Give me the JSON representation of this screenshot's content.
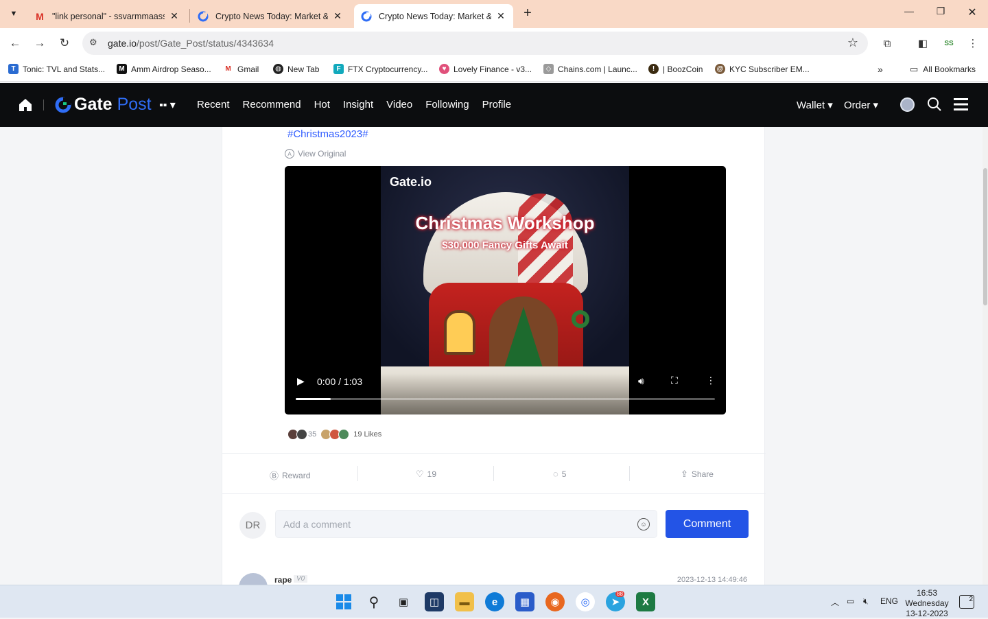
{
  "browser": {
    "tabs": [
      {
        "title": "\"link personal\" - ssvarmmaasso",
        "favicon": "gmail-icon",
        "active": false
      },
      {
        "title": "Crypto News Today: Market & T",
        "favicon": "gate-icon",
        "active": false
      },
      {
        "title": "Crypto News Today: Market & T",
        "favicon": "gate-icon",
        "active": true
      }
    ],
    "url_host": "gate.io",
    "url_path": "/post/Gate_Post/status/4343634",
    "bookmarks": [
      {
        "label": "Tonic: TVL and Stats...",
        "color": "#2a6bd1"
      },
      {
        "label": "Amm Airdrop Seaso...",
        "color": "#111111"
      },
      {
        "label": "Gmail",
        "color": "#d93025"
      },
      {
        "label": "New Tab",
        "color": "#222222"
      },
      {
        "label": "FTX Cryptocurrency...",
        "color": "#11a9bc"
      },
      {
        "label": "Lovely Finance - v3...",
        "color": "#e0507a"
      },
      {
        "label": "Chains.com | Launc...",
        "color": "#9a9a9a"
      },
      {
        "label": "| BoozCoin",
        "color": "#3a2a10"
      },
      {
        "label": "KYC Subscriber EM...",
        "color": "#7a5a3a"
      }
    ],
    "all_bookmarks": "All Bookmarks",
    "more_bookmarks": "»"
  },
  "site": {
    "logo_text": "Gate",
    "logo_post": "Post",
    "nav_links": [
      "Recent",
      "Recommend",
      "Hot",
      "Insight",
      "Video",
      "Following",
      "Profile"
    ],
    "wallet": "Wallet ▾",
    "order": "Order ▾",
    "accent": "#2f6df6"
  },
  "post": {
    "hashtag": "#Christmas2023#",
    "view_original": "View Original",
    "video": {
      "brand": "Gate.io",
      "headline": "Christmas Workshop",
      "subline": "$30,000 Fancy Gifts Await",
      "time": "0:00 / 1:03",
      "progress_fraction": 0.083
    },
    "likers_extra": "35",
    "likes_label": "19 Likes",
    "actions": {
      "reward": "Reward",
      "likes": "19",
      "comments": "5",
      "share": "Share"
    }
  },
  "comment_box": {
    "avatar_initials": "DR",
    "placeholder": "Add a comment",
    "button": "Comment"
  },
  "first_reply": {
    "user": "rape",
    "badge": "V0",
    "time": "2023-12-13 14:49:46"
  },
  "taskbar": {
    "tray_lang": "ENG",
    "time": "16:53",
    "day": "Wednesday",
    "date": "13-12-2023",
    "notifications": "2",
    "telegram_badge": "88"
  }
}
